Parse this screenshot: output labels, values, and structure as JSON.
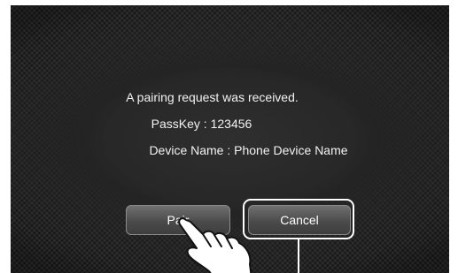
{
  "dialog": {
    "message": "A pairing request was received.",
    "passkey_line": "PassKey : 123456",
    "device_line": "Device Name : Phone Device Name"
  },
  "buttons": {
    "pair_label": "Pair",
    "cancel_label": "Cancel"
  },
  "icons": {
    "pointer": "pointing-hand-icon"
  }
}
